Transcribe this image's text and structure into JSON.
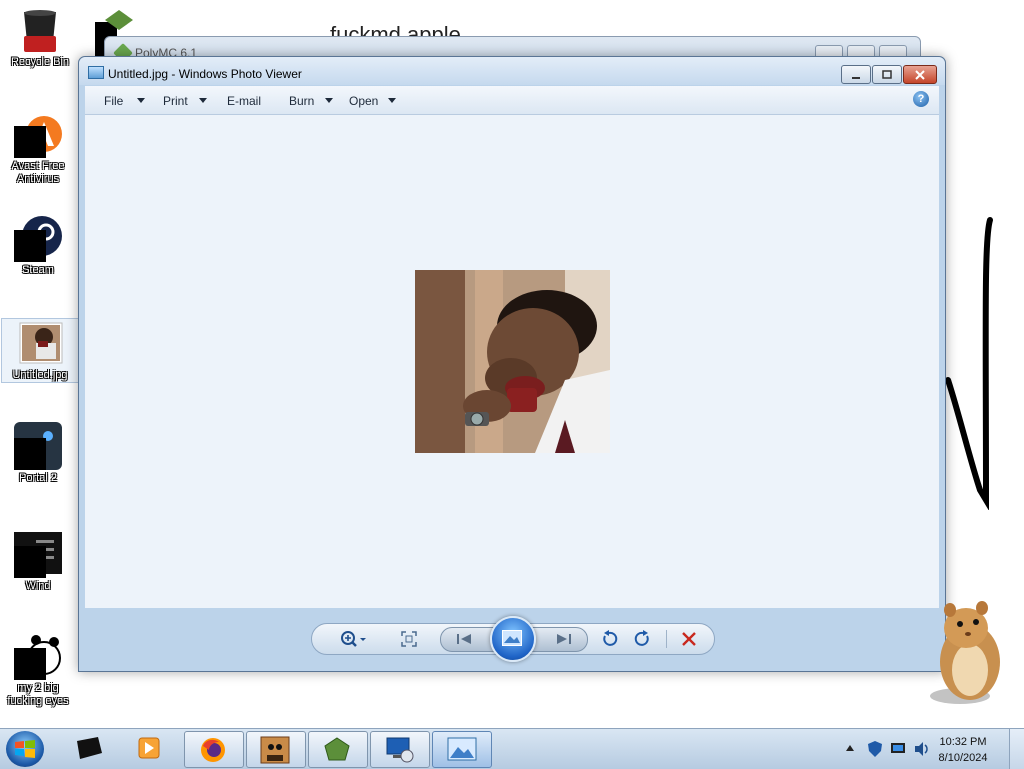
{
  "desktop": {
    "icons": [
      {
        "label": "Recycle Bin",
        "icon": "recycle-bin-icon"
      },
      {
        "label": "Avast Free Antivirus",
        "icon": "avast-icon"
      },
      {
        "label": "Steam",
        "icon": "steam-icon"
      },
      {
        "label": "Untitled.jpg",
        "icon": "image-file-icon"
      },
      {
        "label": "Portal 2",
        "icon": "portal2-icon"
      },
      {
        "label": "Wind",
        "icon": "wind-app-icon"
      },
      {
        "label": "my 2 big fucking eyes",
        "icon": "panda-icon"
      }
    ]
  },
  "background_window": {
    "title": "PolyMC 6.1",
    "heading": "fuckmd  apple"
  },
  "viewer": {
    "title": "Untitled.jpg - Windows Photo Viewer",
    "menu": [
      "File",
      "Print",
      "E-mail",
      "Burn",
      "Open"
    ],
    "help": "?"
  },
  "taskbar": {
    "time": "10:32 PM",
    "date": "8/10/2024"
  },
  "colors": {
    "viewer_frame": "#bcd3ea",
    "viewer_canvas": "#edf3fa",
    "close_red": "#c4452a",
    "taskbar": "#c8d9ec"
  }
}
